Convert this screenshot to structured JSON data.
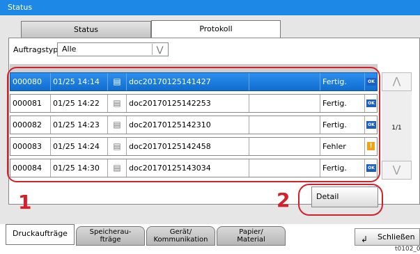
{
  "window": {
    "title": "Status"
  },
  "tabs": [
    {
      "label": "Status",
      "active": false
    },
    {
      "label": "Protokoll",
      "active": true
    }
  ],
  "filter": {
    "label": "Auftragstyp",
    "value": "Alle"
  },
  "jobs": [
    {
      "id": "000080",
      "datetime": "01/25 14:14",
      "icon": "copy-job-icon",
      "name": "doc20170125141427",
      "status": "Fertig.",
      "badge": "OK",
      "selected": true
    },
    {
      "id": "000081",
      "datetime": "01/25 14:22",
      "icon": "print-job-icon",
      "name": "doc20170125142253",
      "status": "Fertig.",
      "badge": "OK",
      "selected": false
    },
    {
      "id": "000082",
      "datetime": "01/25 14:23",
      "icon": "copy-job-icon",
      "name": "doc20170125142310",
      "status": "Fertig.",
      "badge": "OK",
      "selected": false
    },
    {
      "id": "000083",
      "datetime": "01/25 14:24",
      "icon": "copy-job-icon",
      "name": "doc20170125142458",
      "status": "Fehler",
      "badge": "!",
      "selected": false
    },
    {
      "id": "000084",
      "datetime": "01/25 14:30",
      "icon": "copy-job-icon",
      "name": "doc20170125143034",
      "status": "Fertig.",
      "badge": "OK",
      "selected": false
    }
  ],
  "pager": {
    "text": "1/1"
  },
  "detail_button": {
    "label": "Detail"
  },
  "callouts": [
    "1",
    "2"
  ],
  "bottom_tabs": [
    {
      "label": "Druckaufträge",
      "active": true
    },
    {
      "label": "Speicherau-\nfträge",
      "active": false
    },
    {
      "label": "Gerät/\nKommunikation",
      "active": false
    },
    {
      "label": "Papier/\nMaterial",
      "active": false
    }
  ],
  "close_button": {
    "label": "Schließen"
  },
  "ref_code": "t0102_0",
  "colors": {
    "accent": "#1e88e6",
    "highlight": "#d4202a",
    "ok": "#1c5fc4",
    "warning": "#f3a214"
  }
}
